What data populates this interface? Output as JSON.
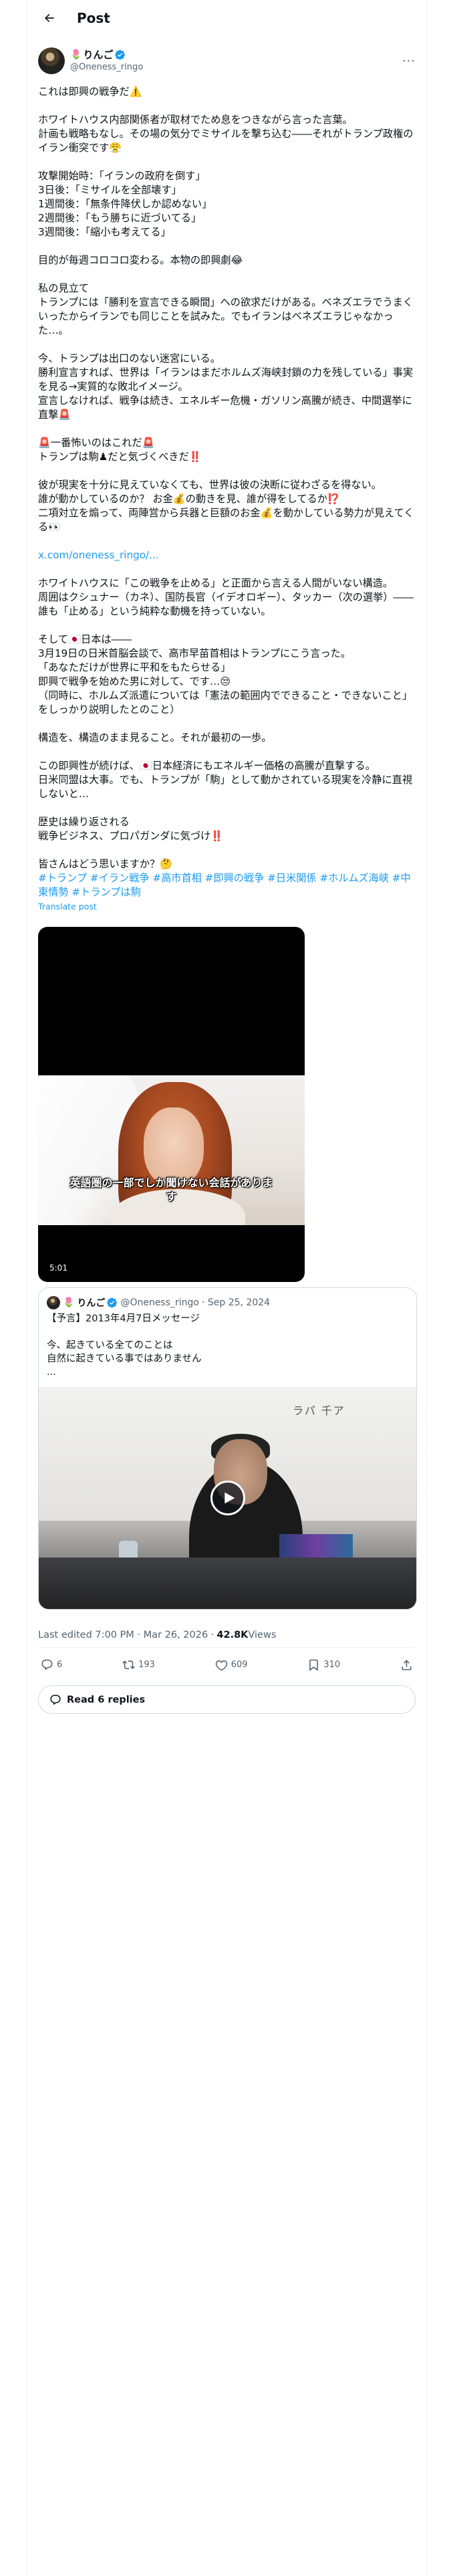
{
  "topbar": {
    "title": "Post"
  },
  "author": {
    "name": "りんご",
    "flower": "🌷",
    "handle": "@Oneness_ringo"
  },
  "post": {
    "paragraphs": [
      "これは即興の戦争だ⚠️",
      "ホワイトハウス内部関係者が取材でため息をつきながら言った言葉。\n計画も戦略もなし。その場の気分でミサイルを撃ち込む――それがトランプ政権のイラン衝突です😤",
      "攻撃開始時：「イランの政府を倒す」\n3日後：「ミサイルを全部壊す」\n1週間後：「無条件降伏しか認めない」\n2週間後：「もう勝ちに近づいてる」\n3週間後：「縮小も考えてる」",
      "目的が毎週コロコロ変わる。本物の即興劇😂",
      "私の見立て\nトランプには「勝利を宣言できる瞬間」への欲求だけがある。ベネズエラでうまくいったからイランでも同じことを試みた。でもイランはベネズエラじゃなかった…。",
      "今、トランプは出口のない迷宮にいる。\n勝利宣言すれば、世界は「イランはまだホルムズ海峡封鎖の力を残している」事実を見る→実質的な敗北イメージ。\n宣言しなければ、戦争は続き、エネルギー危機・ガソリン高騰が続き、中間選挙に直撃🚨",
      "🚨一番怖いのはこれだ🚨\nトランプは駒♟だと気づくべきだ‼️",
      "彼が現実を十分に見えていなくても、世界は彼の決断に従わざるを得ない。\n誰が動かしているのか？ お金💰の動きを見、誰が得をしてるか⁉️\n二項対立を煽って、両陣営から兵器と巨額のお金💰を動かしている勢力が見えてくる👀"
    ],
    "link": "x.com/oneness_ringo/...",
    "paragraphs2": [
      "ホワイトハウスに「この戦争を止める」と正面から言える人間がいない構造。\n周囲はクシュナー（カネ）、国防長官（イデオロギー）、タッカー（次の選挙）――誰も「止める」という純粋な動機を持っていない。",
      "そして🇯🇵日本は――\n3月19日の日米首脳会談で、高市早苗首相はトランプにこう言った。\n「あなただけが世界に平和をもたらせる」\n即興で戦争を始めた男に対して、です…😒\n（同時に、ホルムズ派遣については「憲法の範囲内でできること・できないこと」をしっかり説明したとのこと）",
      "構造を、構造のまま見ること。それが最初の一歩。",
      "この即興性が続けば、🇯🇵日本経済にもエネルギー価格の高騰が直撃する。\n日米同盟は大事。でも、トランプが「駒」として動かされている現実を冷静に直視しないと…",
      "歴史は繰り返される\n戦争ビジネス、プロパガンダに気づけ‼️",
      "皆さんはどう思いますか？🤔"
    ],
    "hashtags": "#トランプ #イラン戦争 #高市首相 #即興の戦争 #日米関係 #ホルムズ海峡 #中東情勢 #トランプは駒",
    "translate": "Translate post"
  },
  "video": {
    "subtitle": "英語圏の一部でしか聞けない会話がありま\nす",
    "duration": "5:01"
  },
  "quote": {
    "name": "りんご",
    "flower": "🌷",
    "handle": "@Oneness_ringo",
    "date": "· Sep 25, 2024",
    "text": "【予言】2013年4月7日メッセージ\n\n今、起きている全てのことは\n自然に起きている事ではありません\n...",
    "board_text": "ラパ 千ア"
  },
  "meta": {
    "edited": "Last edited 7:00 PM · Mar 26, 2026 · ",
    "views_count": "42.8K",
    "views_label": " Views"
  },
  "actions": {
    "replies": "6",
    "reposts": "193",
    "likes": "609",
    "bookmarks": "310"
  },
  "read_replies": "Read 6 replies",
  "colors": {
    "accent": "#1d9bf0",
    "text": "#0f1419",
    "muted": "#536471",
    "border": "#cfd9de"
  }
}
